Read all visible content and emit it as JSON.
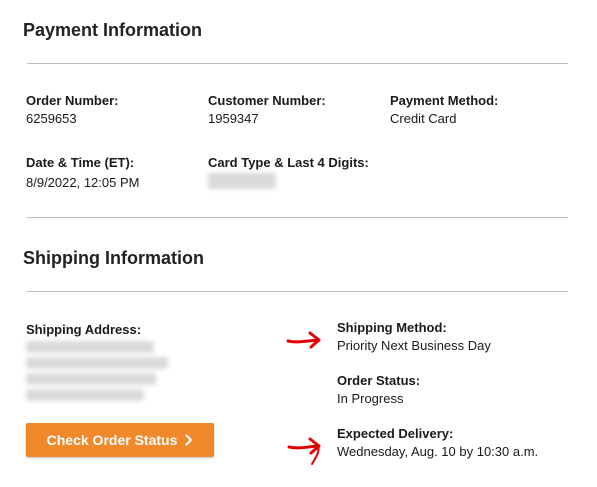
{
  "payment": {
    "title": "Payment Information",
    "order_number_label": "Order Number:",
    "order_number_value": "6259653",
    "customer_number_label": "Customer Number:",
    "customer_number_value": "1959347",
    "payment_method_label": "Payment Method:",
    "payment_method_value": "Credit Card",
    "datetime_label": "Date & Time (ET):",
    "datetime_value": "8/9/2022, 12:05 PM",
    "card_type_label": "Card Type & Last 4 Digits:"
  },
  "shipping": {
    "title": "Shipping Information",
    "address_label": "Shipping Address:",
    "method_label": "Shipping Method:",
    "method_value": "Priority Next Business Day",
    "status_label": "Order Status:",
    "status_value": "In Progress",
    "delivery_label": "Expected Delivery:",
    "delivery_value": "Wednesday, Aug. 10 by 10:30 a.m.",
    "check_button_label": "Check Order Status"
  },
  "colors": {
    "button": "#f0892b",
    "annotation_arrow": "#e00000",
    "divider": "#bdbdbd"
  },
  "icons": {
    "button_icon": "chevron-right-icon",
    "annotation": "red-arrow-icon"
  }
}
